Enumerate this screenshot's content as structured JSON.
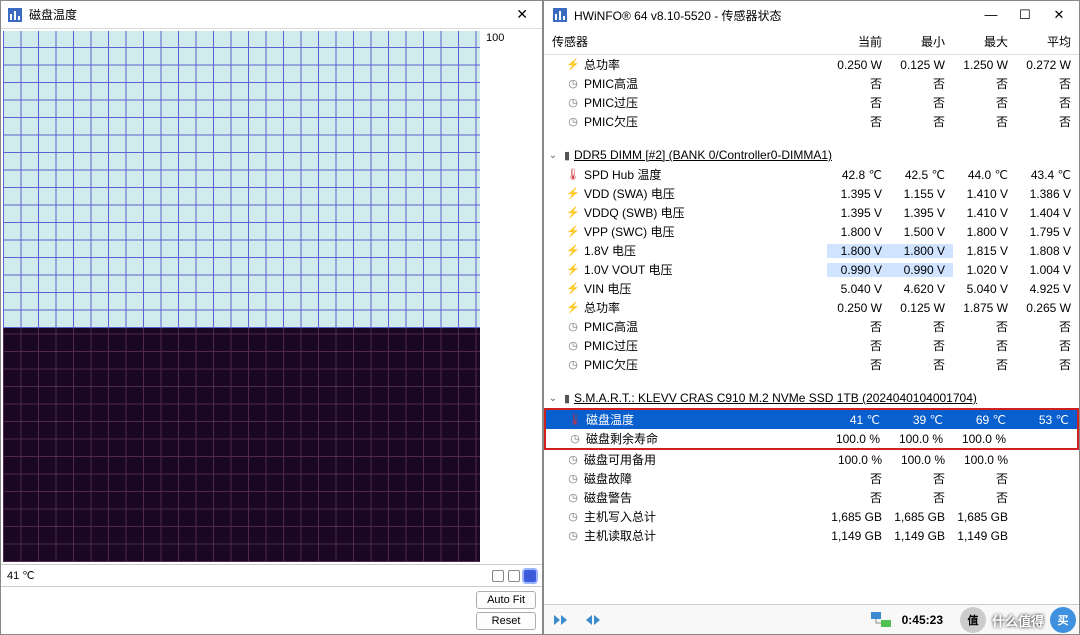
{
  "left_window": {
    "title": "磁盘温度",
    "y_max": "100",
    "temp_readout": "41 ℃",
    "auto_fit": "Auto Fit",
    "reset": "Reset"
  },
  "right_window": {
    "title": "HWiNFO® 64 v8.10-5520 - 传感器状态",
    "elapsed": "0:45:23",
    "headers": {
      "sensor": "传感器",
      "current": "当前",
      "min": "最小",
      "max": "最大",
      "avg": "平均"
    },
    "rows": [
      {
        "icon": "power",
        "name": "总功率",
        "cur": "0.250 W",
        "min": "0.125 W",
        "max": "1.250 W",
        "avg": "0.272 W",
        "indent": 1
      },
      {
        "icon": "clock",
        "name": "PMIC高温",
        "cur": "否",
        "min": "否",
        "max": "否",
        "avg": "否",
        "indent": 1
      },
      {
        "icon": "clock",
        "name": "PMIC过压",
        "cur": "否",
        "min": "否",
        "max": "否",
        "avg": "否",
        "indent": 1
      },
      {
        "icon": "clock",
        "name": "PMIC欠压",
        "cur": "否",
        "min": "否",
        "max": "否",
        "avg": "否",
        "indent": 1
      },
      {
        "type": "spacer"
      },
      {
        "type": "section",
        "name": "DDR5 DIMM [#2] (BANK 0/Controller0-DIMMA1)"
      },
      {
        "icon": "temp",
        "name": "SPD Hub 温度",
        "cur": "42.8 ℃",
        "min": "42.5 ℃",
        "max": "44.0 ℃",
        "avg": "43.4 ℃",
        "indent": 1
      },
      {
        "icon": "power",
        "name": "VDD (SWA) 电压",
        "cur": "1.395 V",
        "min": "1.155 V",
        "max": "1.410 V",
        "avg": "1.386 V",
        "indent": 1
      },
      {
        "icon": "power",
        "name": "VDDQ (SWB) 电压",
        "cur": "1.395 V",
        "min": "1.395 V",
        "max": "1.410 V",
        "avg": "1.404 V",
        "indent": 1
      },
      {
        "icon": "power",
        "name": "VPP (SWC) 电压",
        "cur": "1.800 V",
        "min": "1.500 V",
        "max": "1.800 V",
        "avg": "1.795 V",
        "indent": 1
      },
      {
        "icon": "power",
        "name": "1.8V 电压",
        "cur": "1.800 V",
        "min": "1.800 V",
        "max": "1.815 V",
        "avg": "1.808 V",
        "hl": true,
        "indent": 1
      },
      {
        "icon": "power",
        "name": "1.0V VOUT 电压",
        "cur": "0.990 V",
        "min": "0.990 V",
        "max": "1.020 V",
        "avg": "1.004 V",
        "hl": true,
        "indent": 1
      },
      {
        "icon": "power",
        "name": "VIN 电压",
        "cur": "5.040 V",
        "min": "4.620 V",
        "max": "5.040 V",
        "avg": "4.925 V",
        "indent": 1
      },
      {
        "icon": "power",
        "name": "总功率",
        "cur": "0.250 W",
        "min": "0.125 W",
        "max": "1.875 W",
        "avg": "0.265 W",
        "indent": 1
      },
      {
        "icon": "clock",
        "name": "PMIC高温",
        "cur": "否",
        "min": "否",
        "max": "否",
        "avg": "否",
        "indent": 1
      },
      {
        "icon": "clock",
        "name": "PMIC过压",
        "cur": "否",
        "min": "否",
        "max": "否",
        "avg": "否",
        "indent": 1
      },
      {
        "icon": "clock",
        "name": "PMIC欠压",
        "cur": "否",
        "min": "否",
        "max": "否",
        "avg": "否",
        "indent": 1
      },
      {
        "type": "spacer"
      },
      {
        "type": "section",
        "name": "S.M.A.R.T.: KLEVV CRAS C910 M.2 NVMe SSD 1TB (2024040104001704)"
      },
      {
        "icon": "temp",
        "name": "磁盘温度",
        "cur": "41 ℃",
        "min": "39 ℃",
        "max": "69 ℃",
        "avg": "53 ℃",
        "sel": true,
        "indent": 1
      },
      {
        "icon": "clock",
        "name": "磁盘剩余寿命",
        "cur": "100.0 %",
        "min": "100.0 %",
        "max": "100.0 %",
        "avg": "",
        "indent": 1
      },
      {
        "icon": "clock",
        "name": "磁盘可用备用",
        "cur": "100.0 %",
        "min": "100.0 %",
        "max": "100.0 %",
        "avg": "",
        "indent": 1
      },
      {
        "icon": "clock",
        "name": "磁盘故障",
        "cur": "否",
        "min": "否",
        "max": "否",
        "avg": "",
        "indent": 1
      },
      {
        "icon": "clock",
        "name": "磁盘警告",
        "cur": "否",
        "min": "否",
        "max": "否",
        "avg": "",
        "indent": 1
      },
      {
        "icon": "clock",
        "name": "主机写入总计",
        "cur": "1,685 GB",
        "min": "1,685 GB",
        "max": "1,685 GB",
        "avg": "",
        "indent": 1
      },
      {
        "icon": "clock",
        "name": "主机读取总计",
        "cur": "1,149 GB",
        "min": "1,149 GB",
        "max": "1,149 GB",
        "avg": "",
        "indent": 1
      }
    ]
  },
  "watermark": "什么值得"
}
